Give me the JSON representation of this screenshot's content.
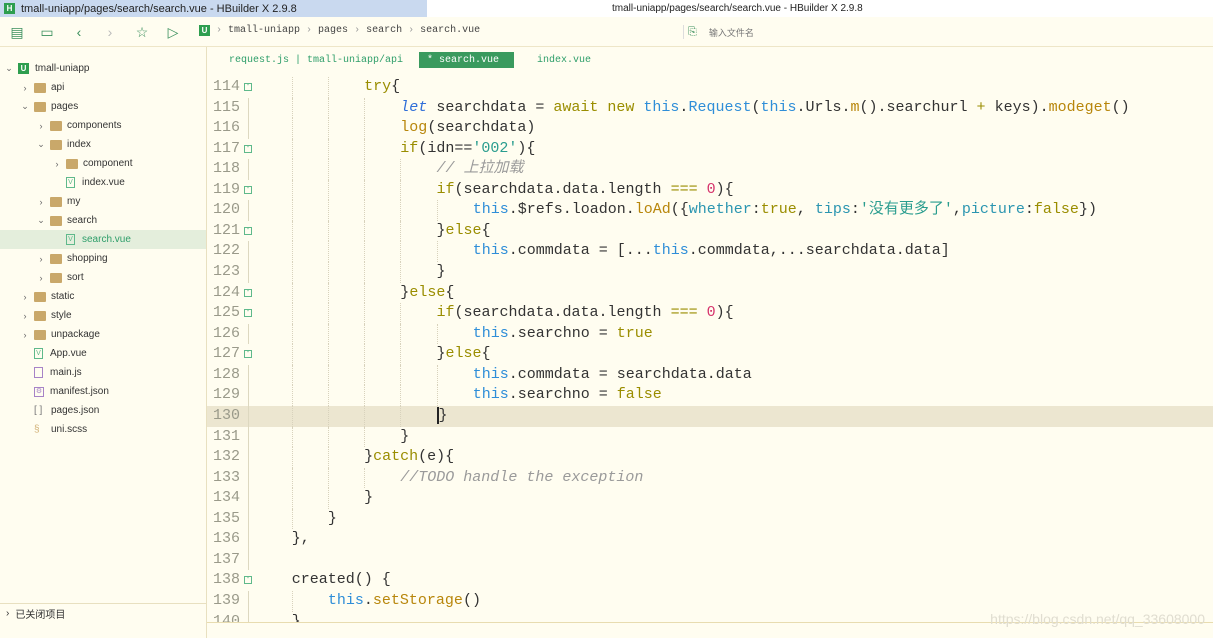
{
  "window": {
    "tab_title": "tmall-uniapp/pages/search/search.vue - HBuilder X 2.9.8",
    "title": "tmall-uniapp/pages/search/search.vue - HBuilder X 2.9.8",
    "logo": "H"
  },
  "toolbar": {
    "icons": [
      "new-file-icon",
      "save-icon",
      "back-icon",
      "forward-icon",
      "star-icon",
      "run-icon"
    ]
  },
  "breadcrumb": {
    "logo": "U",
    "items": [
      "tmall-uniapp",
      "pages",
      "search",
      "search.vue"
    ]
  },
  "file_search": {
    "placeholder": "输入文件名"
  },
  "tabs": [
    {
      "label": "request.js | tmall-uniapp/api"
    },
    {
      "label": "* search.vue",
      "active": true
    },
    {
      "label": "index.vue"
    }
  ],
  "sidebar": {
    "items": [
      {
        "label": "tmall-uniapp",
        "type": "project",
        "depth": 0,
        "expanded": true
      },
      {
        "label": "api",
        "type": "folder",
        "depth": 1,
        "expanded": false
      },
      {
        "label": "pages",
        "type": "folder",
        "depth": 1,
        "expanded": true
      },
      {
        "label": "components",
        "type": "folder",
        "depth": 2,
        "expanded": false
      },
      {
        "label": "index",
        "type": "folder",
        "depth": 2,
        "expanded": true
      },
      {
        "label": "component",
        "type": "folder",
        "depth": 3,
        "expanded": false
      },
      {
        "label": "index.vue",
        "type": "vue",
        "depth": 3
      },
      {
        "label": "my",
        "type": "folder",
        "depth": 2,
        "expanded": false
      },
      {
        "label": "search",
        "type": "folder",
        "depth": 2,
        "expanded": true
      },
      {
        "label": "search.vue",
        "type": "vue",
        "depth": 3,
        "selected": true
      },
      {
        "label": "shopping",
        "type": "folder",
        "depth": 2,
        "expanded": false
      },
      {
        "label": "sort",
        "type": "folder",
        "depth": 2,
        "expanded": false
      },
      {
        "label": "static",
        "type": "folder",
        "depth": 1,
        "expanded": false
      },
      {
        "label": "style",
        "type": "folder",
        "depth": 1,
        "expanded": false
      },
      {
        "label": "unpackage",
        "type": "folder",
        "depth": 1,
        "expanded": false
      },
      {
        "label": "App.vue",
        "type": "vue",
        "depth": 1
      },
      {
        "label": "main.js",
        "type": "js",
        "depth": 1
      },
      {
        "label": "manifest.json",
        "type": "json",
        "depth": 1
      },
      {
        "label": "pages.json",
        "type": "brk",
        "depth": 1
      },
      {
        "label": "uni.scss",
        "type": "scss",
        "depth": 1
      }
    ],
    "closed_projects": "已关闭项目"
  },
  "editor": {
    "current_line": 130,
    "lines": [
      {
        "n": 114,
        "indent": 3,
        "fold": true,
        "t": [
          [
            "kw",
            "try"
          ],
          [
            "p",
            "{"
          ]
        ]
      },
      {
        "n": 115,
        "indent": 4,
        "t": [
          [
            "let",
            "let"
          ],
          [
            "p",
            " searchdata = "
          ],
          [
            "kw",
            "await"
          ],
          [
            "p",
            " "
          ],
          [
            "kw",
            "new"
          ],
          [
            "p",
            " "
          ],
          [
            "this",
            "this"
          ],
          [
            "p",
            "."
          ],
          [
            "this",
            "Request"
          ],
          [
            "p",
            "("
          ],
          [
            "this",
            "this"
          ],
          [
            "p",
            ".Urls."
          ],
          [
            "fn",
            "m"
          ],
          [
            "p",
            "().searchurl "
          ],
          [
            "kw",
            "+"
          ],
          [
            "p",
            " keys)."
          ],
          [
            "fn",
            "modeget"
          ],
          [
            "p",
            "()"
          ]
        ]
      },
      {
        "n": 116,
        "indent": 4,
        "t": [
          [
            "fn",
            "log"
          ],
          [
            "p",
            "(searchdata)"
          ]
        ]
      },
      {
        "n": 117,
        "indent": 4,
        "fold": true,
        "t": [
          [
            "kw",
            "if"
          ],
          [
            "p",
            "(idn=="
          ],
          [
            "str",
            "'002'"
          ],
          [
            "p",
            "){"
          ]
        ]
      },
      {
        "n": 118,
        "indent": 5,
        "t": [
          [
            "cmt",
            "// 上拉加载"
          ]
        ]
      },
      {
        "n": 119,
        "indent": 5,
        "fold": true,
        "t": [
          [
            "kw",
            "if"
          ],
          [
            "p",
            "(searchdata.data.length "
          ],
          [
            "kw",
            "==="
          ],
          [
            "p",
            " "
          ],
          [
            "num",
            "0"
          ],
          [
            "p",
            "){"
          ]
        ]
      },
      {
        "n": 120,
        "indent": 6,
        "t": [
          [
            "this",
            "this"
          ],
          [
            "p",
            ".$refs.loadon."
          ],
          [
            "fn",
            "loAd"
          ],
          [
            "p",
            "({"
          ],
          [
            "prop",
            "whether"
          ],
          [
            "p",
            ":"
          ],
          [
            "kw",
            "true"
          ],
          [
            "p",
            ", "
          ],
          [
            "prop",
            "tips"
          ],
          [
            "p",
            ":"
          ],
          [
            "str",
            "'没有更多了'"
          ],
          [
            "p",
            ","
          ],
          [
            "prop",
            "picture"
          ],
          [
            "p",
            ":"
          ],
          [
            "kw",
            "false"
          ],
          [
            "p",
            "})"
          ]
        ]
      },
      {
        "n": 121,
        "indent": 5,
        "fold": true,
        "t": [
          [
            "p",
            "}"
          ],
          [
            "kw",
            "else"
          ],
          [
            "p",
            "{"
          ]
        ]
      },
      {
        "n": 122,
        "indent": 6,
        "t": [
          [
            "this",
            "this"
          ],
          [
            "p",
            ".commdata = [..."
          ],
          [
            "this",
            "this"
          ],
          [
            "p",
            ".commdata,...searchdata.data]"
          ]
        ]
      },
      {
        "n": 123,
        "indent": 5,
        "t": [
          [
            "p",
            "}"
          ]
        ]
      },
      {
        "n": 124,
        "indent": 4,
        "fold": true,
        "t": [
          [
            "p",
            "}"
          ],
          [
            "kw",
            "else"
          ],
          [
            "p",
            "{"
          ]
        ]
      },
      {
        "n": 125,
        "indent": 5,
        "fold": true,
        "t": [
          [
            "kw",
            "if"
          ],
          [
            "p",
            "(searchdata.data.length "
          ],
          [
            "kw",
            "==="
          ],
          [
            "p",
            " "
          ],
          [
            "num",
            "0"
          ],
          [
            "p",
            "){"
          ]
        ]
      },
      {
        "n": 126,
        "indent": 6,
        "t": [
          [
            "this",
            "this"
          ],
          [
            "p",
            ".searchno = "
          ],
          [
            "kw",
            "true"
          ]
        ]
      },
      {
        "n": 127,
        "indent": 5,
        "fold": true,
        "t": [
          [
            "p",
            "}"
          ],
          [
            "kw",
            "else"
          ],
          [
            "p",
            "{"
          ]
        ]
      },
      {
        "n": 128,
        "indent": 6,
        "t": [
          [
            "this",
            "this"
          ],
          [
            "p",
            ".commdata = searchdata.data"
          ]
        ]
      },
      {
        "n": 129,
        "indent": 6,
        "t": [
          [
            "this",
            "this"
          ],
          [
            "p",
            ".searchno = "
          ],
          [
            "kw",
            "false"
          ]
        ]
      },
      {
        "n": 130,
        "indent": 5,
        "t": [
          [
            "p",
            "}"
          ]
        ]
      },
      {
        "n": 131,
        "indent": 4,
        "t": [
          [
            "p",
            "}"
          ]
        ]
      },
      {
        "n": 132,
        "indent": 3,
        "t": [
          [
            "p",
            "}"
          ],
          [
            "kw",
            "catch"
          ],
          [
            "p",
            "(e){"
          ]
        ]
      },
      {
        "n": 133,
        "indent": 4,
        "t": [
          [
            "cmt",
            "//TODO handle the exception"
          ]
        ]
      },
      {
        "n": 134,
        "indent": 3,
        "t": [
          [
            "p",
            "}"
          ]
        ]
      },
      {
        "n": 135,
        "indent": 2,
        "t": [
          [
            "p",
            "}"
          ]
        ]
      },
      {
        "n": 136,
        "indent": 1,
        "t": [
          [
            "p",
            "},"
          ]
        ]
      },
      {
        "n": 137,
        "indent": 0,
        "t": []
      },
      {
        "n": 138,
        "indent": 1,
        "fold": true,
        "t": [
          [
            "p",
            "created() {"
          ]
        ]
      },
      {
        "n": 139,
        "indent": 2,
        "t": [
          [
            "this",
            "this"
          ],
          [
            "p",
            "."
          ],
          [
            "fn",
            "setStorage"
          ],
          [
            "p",
            "()"
          ]
        ]
      },
      {
        "n": 140,
        "indent": 1,
        "t": [
          [
            "p",
            "}"
          ]
        ]
      }
    ]
  },
  "watermark": "https://blog.csdn.net/qq_33608000"
}
